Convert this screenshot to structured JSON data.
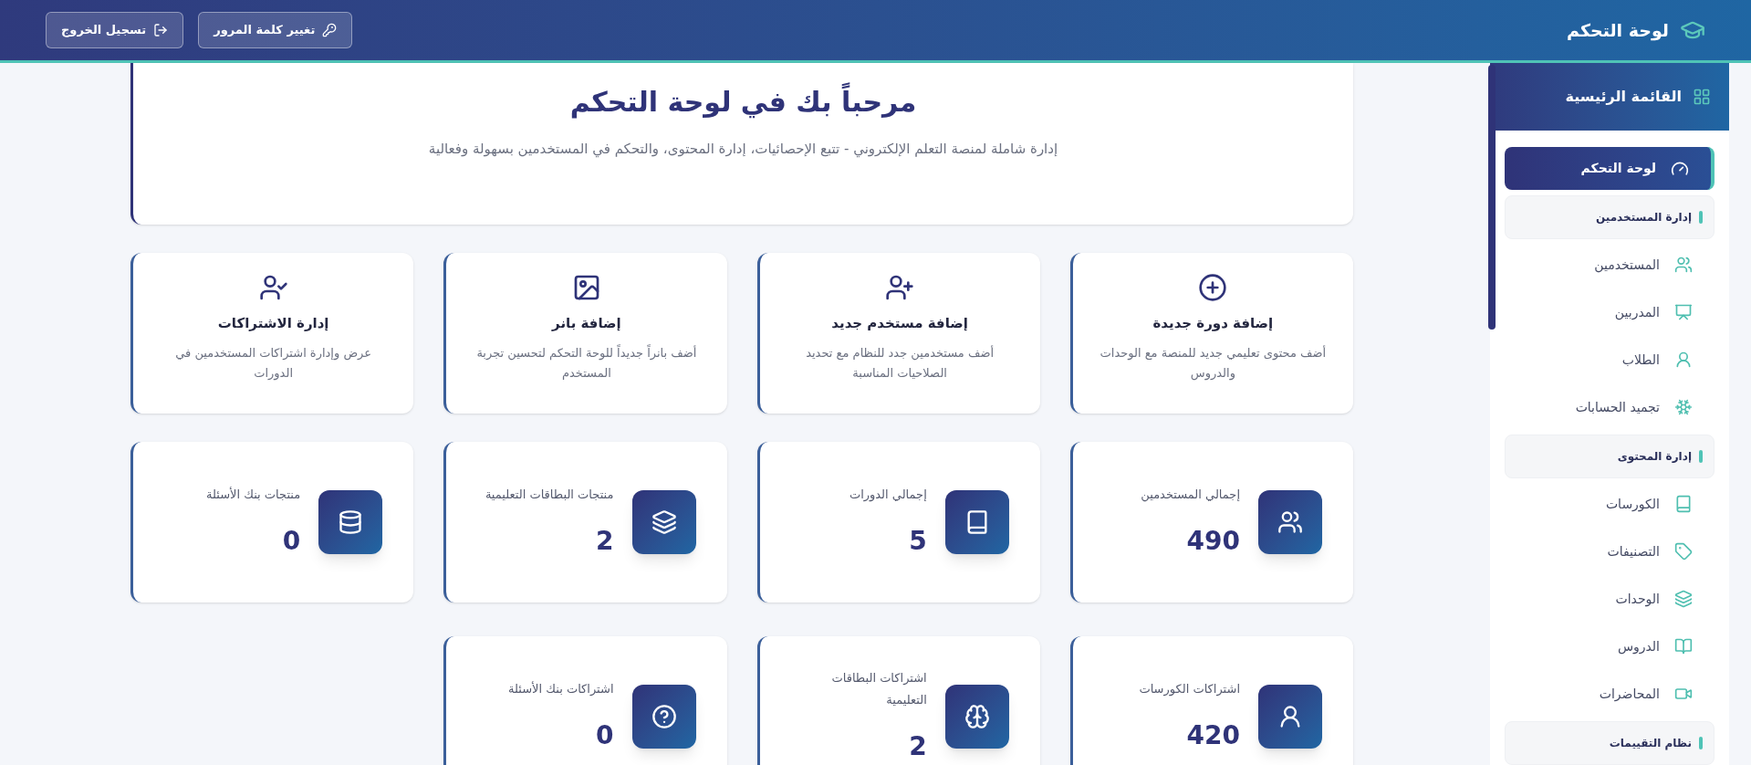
{
  "header": {
    "title": "لوحة التحكم",
    "buttons": [
      {
        "label": "تغيير كلمة المرور",
        "kind": "password"
      },
      {
        "label": "تسجيل الخروج",
        "kind": "logout"
      }
    ]
  },
  "sidebar": {
    "title": "القائمة الرئيسية",
    "items": [
      {
        "kind": "link",
        "label": "لوحة التحكم",
        "selected": true
      },
      {
        "kind": "section",
        "label": "إدارة المستخدمين"
      },
      {
        "kind": "link",
        "label": "المستخدمين",
        "selected": false
      },
      {
        "kind": "link",
        "label": "المدربين",
        "selected": false
      },
      {
        "kind": "link",
        "label": "الطلاب",
        "selected": false
      },
      {
        "kind": "link",
        "label": "تجميد الحسابات",
        "selected": false
      },
      {
        "kind": "section",
        "label": "إدارة المحتوى"
      },
      {
        "kind": "link",
        "label": "الكورسات",
        "selected": false
      },
      {
        "kind": "link",
        "label": "التصنيفات",
        "selected": false
      },
      {
        "kind": "link",
        "label": "الوحدات",
        "selected": false
      },
      {
        "kind": "link",
        "label": "الدروس",
        "selected": false
      },
      {
        "kind": "link",
        "label": "المحاضرات",
        "selected": false
      },
      {
        "kind": "section",
        "label": "نظام التقييمات"
      }
    ]
  },
  "welcome": {
    "title": "مرحباً بك في لوحة التحكم",
    "description": "إدارة شاملة لمنصة التعلم الإلكتروني - تتبع الإحصائيات، إدارة المحتوى، والتحكم في المستخدمين بسهولة وفعالية"
  },
  "actions": [
    {
      "title": "إضافة دورة جديدة",
      "description": "أضف محتوى تعليمي جديد للمنصة مع الوحدات والدروس"
    },
    {
      "title": "إضافة مستخدم جديد",
      "description": "أضف مستخدمين جدد للنظام مع تحديد الصلاحيات المناسبة"
    },
    {
      "title": "إضافة بانر",
      "description": "أضف بانراً جديداً للوحة التحكم لتحسين تجربة المستخدم"
    },
    {
      "title": "إدارة الاشتراكات",
      "description": "عرض وإدارة اشتراكات المستخدمين في الدورات"
    }
  ],
  "stats": [
    {
      "label": "إجمالي المستخدمين",
      "value": "490"
    },
    {
      "label": "إجمالي الدورات",
      "value": "5"
    },
    {
      "label": "منتجات البطاقات التعليمية",
      "value": "2"
    },
    {
      "label": "منتجات بنك الأسئلة",
      "value": "0"
    },
    {
      "label": "اشتراكات الكورسات",
      "value": "420"
    },
    {
      "label": "اشتراكات البطاقات التعليمية",
      "value": "2"
    },
    {
      "label": "اشتراكات بنك الأسئلة",
      "value": "0"
    }
  ]
}
